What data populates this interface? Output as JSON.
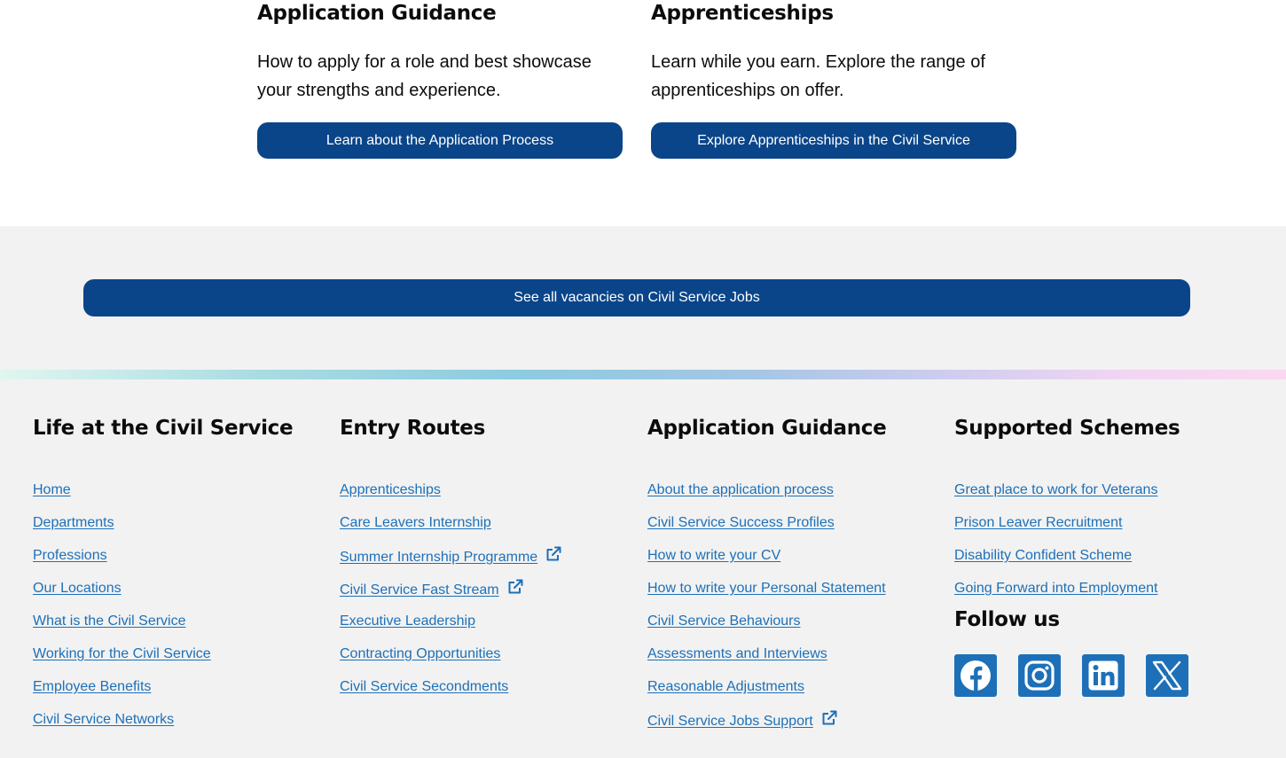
{
  "cards": [
    {
      "title": "Application Guidance",
      "text": "How to apply for a role and best showcase your strengths and experience.",
      "button": "Learn about the Application Process"
    },
    {
      "title": "Apprenticeships",
      "text": "Learn while you earn. Explore the range of apprenticeships on offer.",
      "button": "Explore Apprenticeships in the Civil Service"
    }
  ],
  "all_vacancies_button": "See all vacancies on Civil Service Jobs",
  "footer": {
    "columns": [
      {
        "title": "Life at the Civil Service",
        "links": [
          "Home",
          "Departments",
          "Professions",
          "Our Locations",
          "What is the Civil Service",
          "Working for the Civil Service",
          "Employee Benefits",
          "Civil Service Networks"
        ]
      },
      {
        "title": "Entry Routes",
        "links": [
          "Apprenticeships",
          "Care Leavers Internship",
          "Summer Internship Programme",
          "Civil Service Fast Stream",
          "Executive Leadership",
          "Contracting Opportunities",
          "Civil Service Secondments"
        ],
        "external_links": [
          "Summer Internship Programme",
          "Civil Service Fast Stream"
        ]
      },
      {
        "title": "Application Guidance",
        "links": [
          "About the application process",
          "Civil Service Success Profiles",
          "How to write your CV",
          "How to write your Personal Statement",
          "Civil Service Behaviours",
          "Assessments and Interviews",
          "Reasonable Adjustments",
          "Civil Service Jobs Support"
        ],
        "external_links": [
          "Civil Service Jobs Support"
        ]
      },
      {
        "title": "Supported Schemes",
        "links": [
          "Great place to work for Veterans",
          "Prison Leaver Recruitment",
          "Disability Confident Scheme",
          "Going Forward into Employment"
        ]
      }
    ],
    "follow_title": "Follow us",
    "socials": [
      "facebook-icon",
      "instagram-icon",
      "linkedin-icon",
      "x-icon"
    ]
  },
  "colors": {
    "button_blue": "#0a4589",
    "link_blue": "#1d70b8",
    "footer_bg": "#f2f2f2"
  }
}
